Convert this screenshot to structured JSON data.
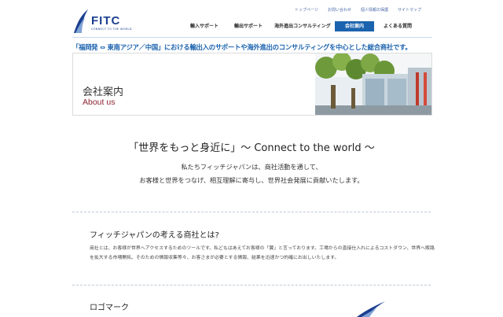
{
  "header": {
    "logo_text": "FITC",
    "logo_sub": "CONNECT TO THE WORLD",
    "util_links": [
      "トップページ",
      "お問い合わせ",
      "個人情報の保護",
      "サイトマップ"
    ],
    "nav": [
      {
        "label": "輸入サポート",
        "active": false
      },
      {
        "label": "輸出サポート",
        "active": false
      },
      {
        "label": "海外進出コンサルティング",
        "active": false
      },
      {
        "label": "会社案内",
        "active": true
      },
      {
        "label": "よくある質問",
        "active": false
      }
    ]
  },
  "tagline": "「福岡発 ⇔ 東南アジア／中国」における輸出入のサポートや海外進出のコンサルティングを中心とした総合商社です。",
  "banner": {
    "title": "会社案内",
    "subtitle": "About us"
  },
  "intro": {
    "title": "「世界をもっと身近に」～ Connect to the world ～",
    "line1": "私たちフィッチジャパンは、商社活動を通して、",
    "line2": "お客様と世界をつなげ、相互理解に寄与し、世界社会発展に貢献いたします。"
  },
  "section1": {
    "title": "フィッチジャパンの考える商社とは?",
    "body": "商社とは、お客様が世界へアクセスするためのツールです。私どもはあえてお客様の「翼」と言っております。工場からの直接仕入れによるコストダウン、世界へ販路を拡大する市場開拓、そのための情報収集等々、お客さまが必要とする情報、結果を迅速かつ的確にお出しいたします。"
  },
  "section2": {
    "title": "ロゴマーク"
  },
  "colors": {
    "brand_blue": "#1b63ae",
    "accent_red": "#8b2332"
  }
}
